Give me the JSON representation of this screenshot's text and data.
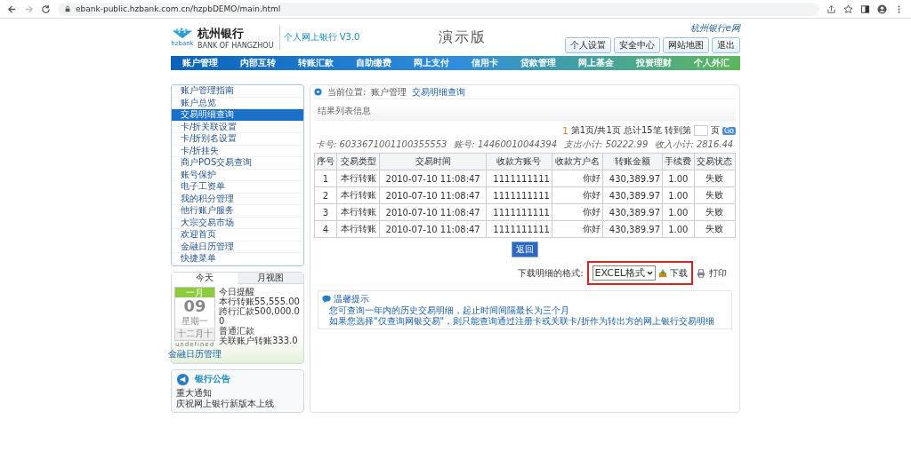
{
  "browser": {
    "url": "ebank-public.hzbank.com.cn/hzpbDEMO/main.html"
  },
  "header": {
    "brand_cn": "杭州银行",
    "brand_en": "BANK OF HANGZHOU",
    "logo_text": "hzbank",
    "product": "个人网上银行 V3.0",
    "demo_label": "演示版",
    "slogan": "杭州银行e网",
    "buttons": [
      "个人设置",
      "安全中心",
      "网站地图",
      "退出"
    ]
  },
  "nav": [
    "账户管理",
    "内部互转",
    "转账汇款",
    "自助缴费",
    "网上支付",
    "信用卡",
    "贷款管理",
    "网上基金",
    "投资理财",
    "个人外汇"
  ],
  "sidebar": {
    "items": [
      {
        "label": "账户管理指南",
        "selected": false
      },
      {
        "label": "账户总览",
        "selected": false
      },
      {
        "label": "交易明细查询",
        "selected": true
      },
      {
        "label": "卡/折关联设置",
        "selected": false
      },
      {
        "label": "卡/折别名设置",
        "selected": false
      },
      {
        "label": "卡/折挂失",
        "selected": false
      },
      {
        "label": "商户POS交易查询",
        "selected": false
      },
      {
        "label": "账号保护",
        "selected": false
      },
      {
        "label": "电子工资单",
        "selected": false
      },
      {
        "label": "我的积分管理",
        "selected": false
      },
      {
        "label": "他行账户服务",
        "selected": false
      },
      {
        "label": "大宗交易市场",
        "selected": false
      },
      {
        "label": "欢迎首页",
        "selected": false
      },
      {
        "label": "金融日历管理",
        "selected": false
      },
      {
        "label": "快捷菜单",
        "selected": false
      }
    ]
  },
  "calendar": {
    "tabs": [
      {
        "label": "今天",
        "selected": true
      },
      {
        "label": "月视图",
        "selected": false
      }
    ],
    "month": "一月",
    "day": "09",
    "weekday": "星期一",
    "lunar": "十二月十",
    "note": "undefined",
    "link": "金融日历管理",
    "reminders": [
      "今日提醒",
      "本行转账55,555.00",
      "跨行汇款500,000.00",
      "普通汇款",
      "关联账户转账333.0"
    ]
  },
  "announcements": {
    "title": "银行公告",
    "items": [
      "重大通知",
      "庆祝网上银行新版本上线"
    ]
  },
  "breadcrumb": {
    "prefix": "当前位置:",
    "items": [
      "账户管理",
      "交易明细查询"
    ]
  },
  "panel_title": "结果列表信息",
  "pagination": {
    "current": "1",
    "summary": "第1页/共1页 总计15笔 转到第",
    "suffix": "页",
    "go": "Go"
  },
  "summary": [
    {
      "label": "卡号:",
      "value": "6033671001100355553"
    },
    {
      "label": "账号:",
      "value": "14460010044394"
    },
    {
      "label": "支出小计:",
      "value": "50222.99"
    },
    {
      "label": "收入小计:",
      "value": "2816.44"
    }
  ],
  "table": {
    "columns": [
      "序号",
      "交易类型",
      "交易时间",
      "收款方账号",
      "收款方户名",
      "转账金额",
      "手续费",
      "交易状态"
    ],
    "rows": [
      [
        "1",
        "本行转账",
        "2010-07-10 11:08:47",
        "1111111111",
        "你好",
        "430,389.97",
        "1.00",
        "失败"
      ],
      [
        "2",
        "本行转账",
        "2010-07-10 11:08:47",
        "1111111111",
        "你好",
        "430,389.97",
        "1.00",
        "失败"
      ],
      [
        "3",
        "本行转账",
        "2010-07-10 11:08:47",
        "1111111111",
        "你好",
        "430,389.97",
        "1.00",
        "失败"
      ],
      [
        "4",
        "本行转账",
        "2010-07-10 11:08:47",
        "1111111111",
        "你好",
        "430,389.97",
        "1.00",
        "失败"
      ]
    ]
  },
  "back_button": "返回",
  "download": {
    "label": "下载明细的格式:",
    "format": "EXCEL格式",
    "download": "下载",
    "print": "打印",
    "highlighted": true
  },
  "tips": {
    "title": "温馨提示",
    "items": [
      "您可查询一年内的历史交易明细，起止时间间隔最长为三个月",
      "如果您选择\"仅查询网银交易\"，则只能查询通过注册卡或关联卡/折作为转出方的网上银行交易明细"
    ]
  }
}
